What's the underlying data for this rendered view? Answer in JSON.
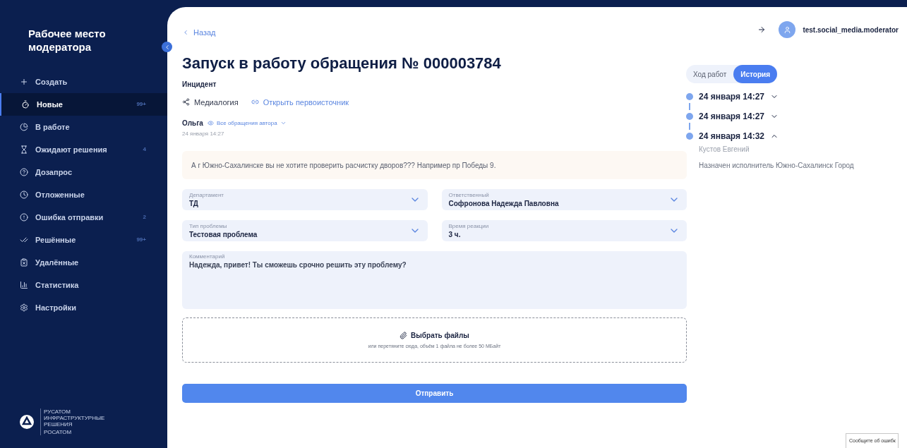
{
  "sidebar": {
    "title": "Рабочее место модератора",
    "items": [
      {
        "kind": "create",
        "label": "Создать",
        "selected": false
      },
      {
        "kind": "new",
        "label": "Новые",
        "count": "99+",
        "selected": true
      },
      {
        "kind": "progress",
        "label": "В работе",
        "selected": false
      },
      {
        "kind": "waiting",
        "label": "Ожидают решения",
        "count": "4",
        "selected": false
      },
      {
        "kind": "question",
        "label": "Дозапрос",
        "selected": false
      },
      {
        "kind": "postponed",
        "label": "Отложенные",
        "selected": false
      },
      {
        "kind": "error",
        "label": "Ошибка отправки",
        "count": "2",
        "selected": false
      },
      {
        "kind": "solved",
        "label": "Решённые",
        "count": "99+",
        "selected": false
      },
      {
        "kind": "deleted",
        "label": "Удалённые",
        "selected": false
      },
      {
        "kind": "stats",
        "label": "Статистика",
        "selected": false
      },
      {
        "kind": "settings",
        "label": "Настройки",
        "selected": false
      }
    ],
    "logo": {
      "lines": [
        "РУСАТОМ",
        "ИНФРАСТРУКТУРНЫЕ",
        "РЕШЕНИЯ"
      ],
      "sub": "РОСАТОМ"
    }
  },
  "back": "Назад",
  "title": "Запуск в работу обращения № 000003784",
  "type": "Инцидент",
  "source": "Медиалогия",
  "source_link": "Открыть первоисточник",
  "author": {
    "name": "Ольга",
    "link": "Все обращения автора",
    "date": "24 января 14:27"
  },
  "message": "А г Южно-Сахалинске вы не хотите проверить расчистку дворов??? Например пр Победы 9.",
  "fields": [
    {
      "label": "Департамент",
      "value": "ТД"
    },
    {
      "label": "Ответственный",
      "value": "Софронова Надежда Павловна"
    },
    {
      "label": "Тип проблемы",
      "value": "Тестовая проблема"
    },
    {
      "label": "Время реакции",
      "value": "3 ч."
    }
  ],
  "comment": {
    "label": "Комментарий",
    "value": "Надежда, привет! Ты сможешь срочно решить эту проблему?"
  },
  "upload": {
    "button": "Выбрать файлы",
    "hint": "или перетяните сюда, объём 1 файла не более 50 МБайт"
  },
  "submit": "Отправить",
  "user": "test.social_media.moderator",
  "tabs": [
    {
      "label": "Ход работ",
      "selected": false
    },
    {
      "label": "История",
      "selected": true
    }
  ],
  "history": [
    {
      "date": "24 января 14:27",
      "expanded": false
    },
    {
      "date": "24 января 14:27",
      "expanded": false
    },
    {
      "date": "24 января 14:32",
      "expanded": true,
      "author": "Кустов Евгений",
      "text": "Назначен исполнитель Южно-Сахалинск Город"
    }
  ],
  "report": "Сообщите об ошибк"
}
